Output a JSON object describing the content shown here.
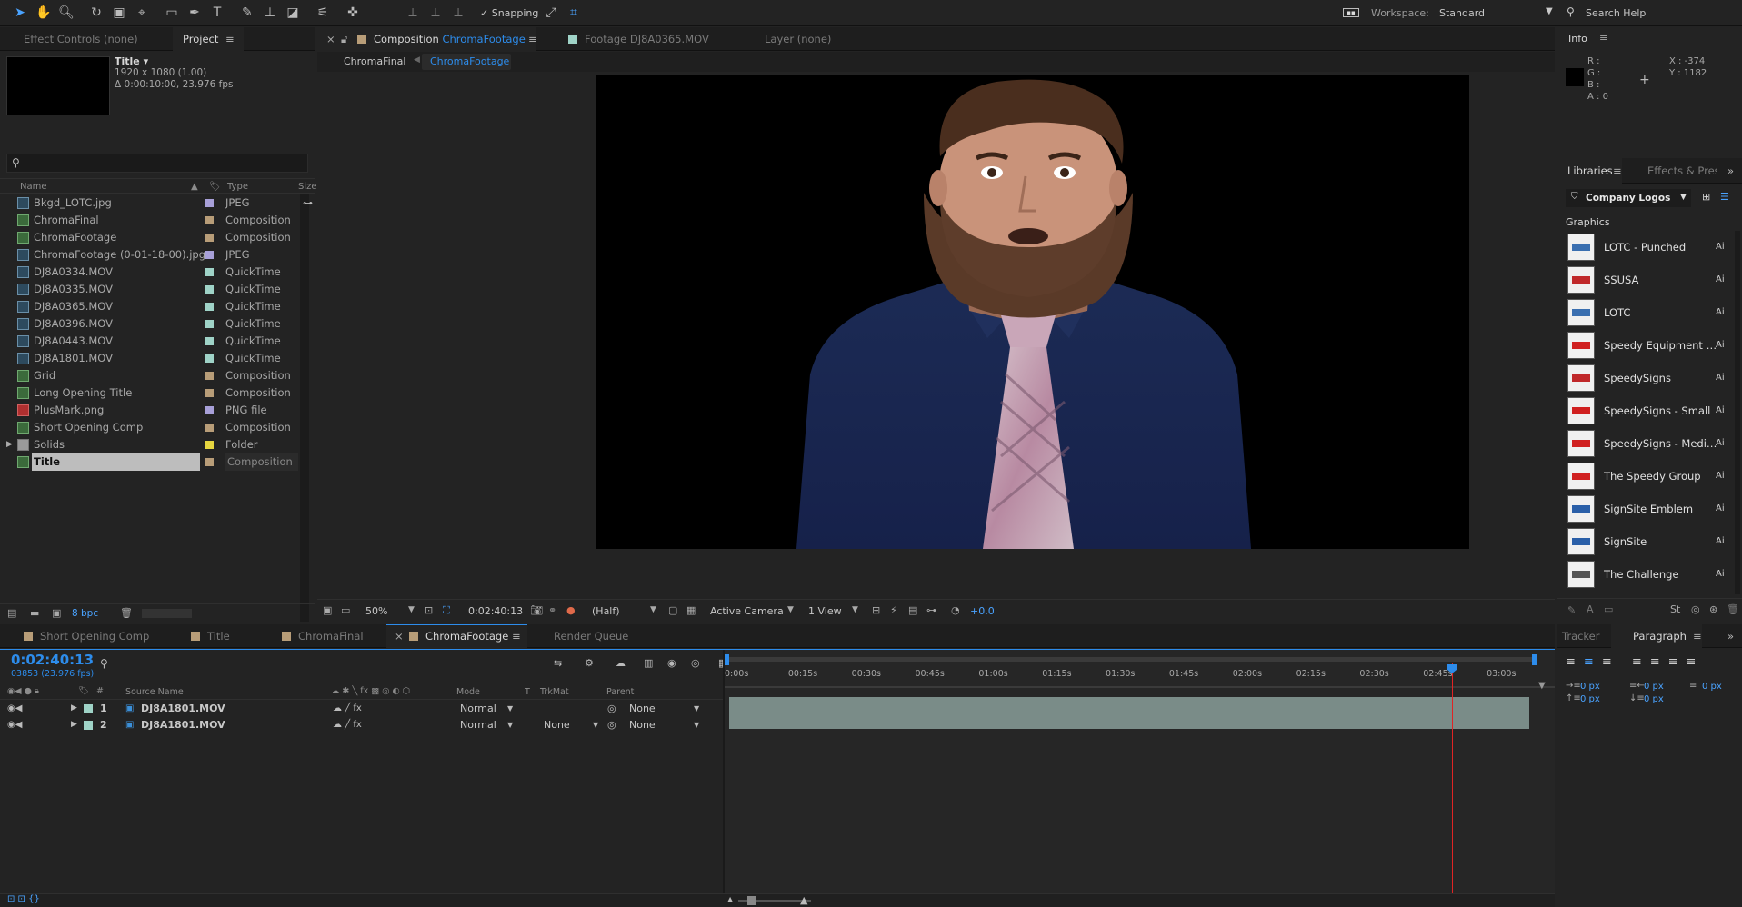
{
  "toolbar": {
    "snapping_label": "Snapping",
    "workspace_label": "Workspace:",
    "workspace_value": "Standard",
    "search_help": "Search Help"
  },
  "left_panel": {
    "tabs": [
      "Effect Controls (none)",
      "Project"
    ],
    "preview": {
      "name": "Title ▾",
      "resolution": "1920 x 1080 (1.00)",
      "duration": "Δ 0:00:10:00, 23.976 fps"
    },
    "columns": {
      "name": "Name",
      "type": "Type",
      "size": "Size"
    },
    "items": [
      {
        "name": "Bkgd_LOTC.jpg",
        "type": "JPEG",
        "color": "#a8a0d8",
        "selected": false
      },
      {
        "name": "ChromaFinal",
        "type": "Composition",
        "color": "#b89d78",
        "selected": false
      },
      {
        "name": "ChromaFootage",
        "type": "Composition",
        "color": "#b89d78",
        "selected": false
      },
      {
        "name": "ChromaFootage (0-01-18-00).jpg",
        "type": "JPEG",
        "color": "#a8a0d8",
        "selected": false
      },
      {
        "name": "DJ8A0334.MOV",
        "type": "QuickTime",
        "color": "#9fd3c7",
        "selected": false
      },
      {
        "name": "DJ8A0335.MOV",
        "type": "QuickTime",
        "color": "#9fd3c7",
        "selected": false
      },
      {
        "name": "DJ8A0365.MOV",
        "type": "QuickTime",
        "color": "#9fd3c7",
        "selected": false
      },
      {
        "name": "DJ8A0396.MOV",
        "type": "QuickTime",
        "color": "#9fd3c7",
        "selected": false
      },
      {
        "name": "DJ8A0443.MOV",
        "type": "QuickTime",
        "color": "#9fd3c7",
        "selected": false
      },
      {
        "name": "DJ8A1801.MOV",
        "type": "QuickTime",
        "color": "#9fd3c7",
        "selected": false
      },
      {
        "name": "Grid",
        "type": "Composition",
        "color": "#b89d78",
        "selected": false
      },
      {
        "name": "Long Opening Title",
        "type": "Composition",
        "color": "#b89d78",
        "selected": false
      },
      {
        "name": "PlusMark.png",
        "type": "PNG file",
        "color": "#a8a0d8",
        "selected": false
      },
      {
        "name": "Short Opening Comp",
        "type": "Composition",
        "color": "#b89d78",
        "selected": false
      },
      {
        "name": "Solids",
        "type": "Folder",
        "color": "#e6d640",
        "selected": false
      },
      {
        "name": "Title",
        "type": "Composition",
        "color": "#b89d78",
        "selected": true
      }
    ],
    "bpc": "8 bpc"
  },
  "viewer": {
    "tabs": [
      "Composition",
      "ChromaFootage",
      "Footage DJ8A0365.MOV",
      "Layer (none)"
    ],
    "breadcrumbs": [
      "ChromaFinal",
      "ChromaFootage"
    ],
    "zoom": "50%",
    "timecode": "0:02:40:13",
    "resolution": "(Half)",
    "camera": "Active Camera",
    "views": "1 View",
    "exposure": "+0.0"
  },
  "info_panel": {
    "title": "Info",
    "r": "R :",
    "g": "G :",
    "b": "B :",
    "a": "A : 0",
    "x": "X : -374",
    "y": "Y : 1182"
  },
  "libraries": {
    "tabs": [
      "Libraries",
      "Effects & Pres"
    ],
    "library": "Company Logos",
    "section": "Graphics",
    "items": [
      {
        "name": "LOTC - Punched",
        "tag": "Ai",
        "thumb": "#3a6fb0"
      },
      {
        "name": "SSUSA",
        "tag": "Ai",
        "thumb": "#c0282a"
      },
      {
        "name": "LOTC",
        "tag": "Ai",
        "thumb": "#3a6fb0"
      },
      {
        "name": "Speedy Equipment Re...",
        "tag": "Ai",
        "thumb": "#d02020"
      },
      {
        "name": "SpeedySigns",
        "tag": "Ai",
        "thumb": "#c0282a"
      },
      {
        "name": "SpeedySigns - Small",
        "tag": "Ai",
        "thumb": "#d02020"
      },
      {
        "name": "SpeedySigns - Medium",
        "tag": "Ai",
        "thumb": "#d02020"
      },
      {
        "name": "The Speedy Group",
        "tag": "Ai",
        "thumb": "#d02020"
      },
      {
        "name": "SignSite Emblem",
        "tag": "Ai",
        "thumb": "#2a5fa8"
      },
      {
        "name": "SignSite",
        "tag": "Ai",
        "thumb": "#2a5fa8"
      },
      {
        "name": "The Challenge",
        "tag": "Ai",
        "thumb": "#555555"
      }
    ]
  },
  "timeline": {
    "tabs": [
      "Short Opening Comp",
      "Title",
      "ChromaFinal",
      "ChromaFootage",
      "Render Queue"
    ],
    "timecode": "0:02:40:13",
    "frames": "03853 (23.976 fps)",
    "columns": {
      "source": "Source Name",
      "mode": "Mode",
      "t": "T",
      "trkmat": "TrkMat",
      "parent": "Parent"
    },
    "layers": [
      {
        "num": "1",
        "name": "DJ8A1801.MOV",
        "mode": "Normal",
        "trkmat": "",
        "parent": "None"
      },
      {
        "num": "2",
        "name": "DJ8A1801.MOV",
        "mode": "Normal",
        "trkmat": "None",
        "parent": "None"
      }
    ],
    "ruler": [
      "0:00s",
      "00:15s",
      "00:30s",
      "00:45s",
      "01:00s",
      "01:15s",
      "01:30s",
      "01:45s",
      "02:00s",
      "02:15s",
      "02:30s",
      "02:45s",
      "03:00s"
    ],
    "playhead_fraction": 0.889
  },
  "paragraph_panel": {
    "tabs": [
      "Tracker",
      "Paragraph"
    ],
    "values": [
      "0 px",
      "0 px",
      "0 px",
      "0 px",
      "0 px"
    ]
  },
  "colors": {
    "accent": "#2d8ceb",
    "playhead": "#e02424",
    "layer_bar": "#7a8c88"
  }
}
